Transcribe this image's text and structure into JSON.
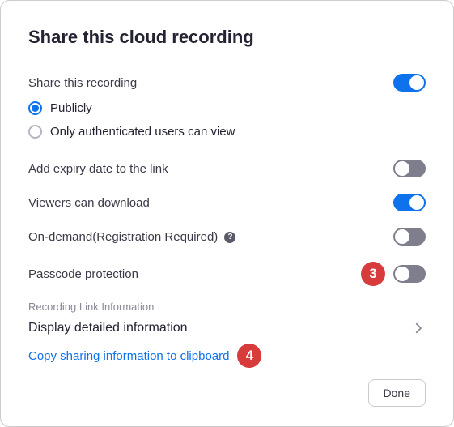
{
  "title": "Share this cloud recording",
  "settings": {
    "share_label": "Share this recording",
    "share_on": true,
    "radio": {
      "publicly": "Publicly",
      "auth_only": "Only authenticated users can view",
      "selected": "publicly"
    },
    "expiry_label": "Add expiry date to the link",
    "expiry_on": false,
    "download_label": "Viewers can download",
    "download_on": true,
    "ondemand_label": "On-demand(Registration Required)",
    "ondemand_on": false,
    "passcode_label": "Passcode protection",
    "passcode_on": false
  },
  "link_info": {
    "section_label": "Recording Link Information",
    "disclosure_label": "Display detailed information",
    "copy_label": "Copy sharing information to clipboard"
  },
  "annotations": {
    "passcode_badge": "3",
    "copy_badge": "4"
  },
  "footer": {
    "done_label": "Done"
  }
}
